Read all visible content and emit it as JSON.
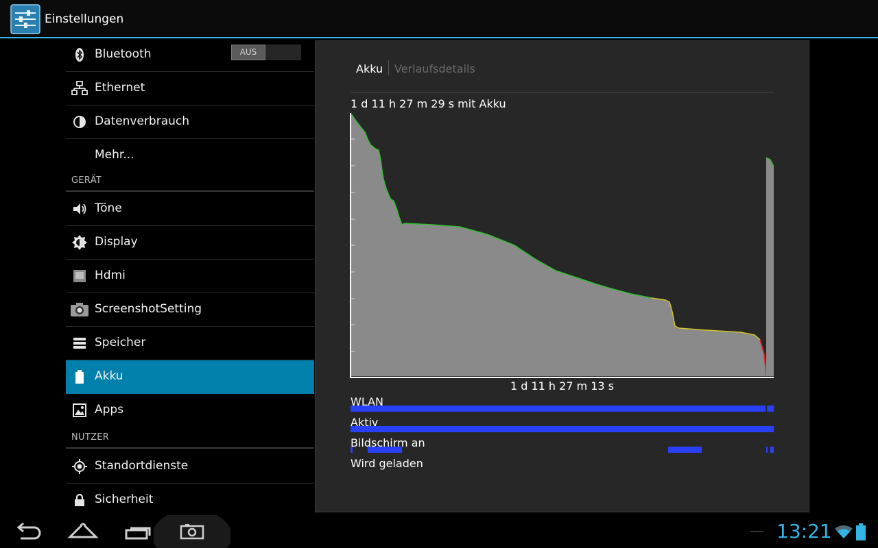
{
  "app": {
    "title": "Einstellungen",
    "icon": "settings-sliders-icon",
    "accent_color": "#33b5e5"
  },
  "sidebar": {
    "wireless_items": [
      {
        "label": "Bluetooth",
        "icon": "bluetooth-icon",
        "toggle": "AUS"
      },
      {
        "label": "Ethernet",
        "icon": "ethernet-icon"
      },
      {
        "label": "Datenverbrauch",
        "icon": "data-usage-icon"
      },
      {
        "label": "Mehr..."
      }
    ],
    "device_header": "GERÄT",
    "device_items": [
      {
        "label": "Töne",
        "icon": "speaker-icon"
      },
      {
        "label": "Display",
        "icon": "brightness-icon"
      },
      {
        "label": "Hdmi",
        "icon": "hdmi-icon"
      },
      {
        "label": "ScreenshotSetting",
        "icon": "camera-icon"
      },
      {
        "label": "Speicher",
        "icon": "storage-icon"
      },
      {
        "label": "Akku",
        "icon": "battery-icon",
        "selected": true
      },
      {
        "label": "Apps",
        "icon": "apps-icon"
      }
    ],
    "user_header": "NUTZER",
    "user_items": [
      {
        "label": "Standortdienste",
        "icon": "location-icon"
      },
      {
        "label": "Sicherheit",
        "icon": "lock-icon"
      }
    ],
    "selected_color": "#0080aa"
  },
  "main": {
    "tabs": [
      {
        "label": "Akku",
        "active": true
      },
      {
        "label": "Verlaufsdetails",
        "active": false
      }
    ],
    "battery_total": "1 d 11 h 27 m 29 s mit Akku",
    "time_label": "1 d 11 h 27 m 13 s",
    "tracks": [
      {
        "label": "WLAN"
      },
      {
        "label": "Aktiv"
      },
      {
        "label": "Bildschirm an"
      },
      {
        "label": "Wird geladen"
      }
    ],
    "track_color": "#2a40f5"
  },
  "status": {
    "time": "13:21",
    "icons": [
      "wifi-icon",
      "battery-icon"
    ]
  },
  "navbar": {
    "buttons": [
      "back-icon",
      "home-icon",
      "recent-apps-icon",
      "screenshot-icon"
    ]
  }
}
